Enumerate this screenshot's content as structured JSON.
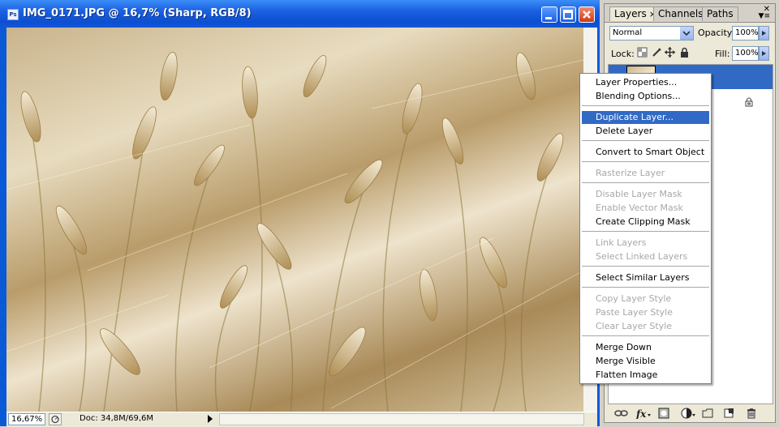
{
  "window": {
    "title": "IMG_0171.JPG @ 16,7% (Sharp, RGB/8)",
    "app_icon_text": "Ps"
  },
  "status": {
    "zoom": "16,67%",
    "doc_info": "Doc: 34,8M/69,6M"
  },
  "layers_panel": {
    "tabs": [
      {
        "label": "Layers",
        "active": true,
        "close": "×"
      },
      {
        "label": "Channels",
        "active": false
      },
      {
        "label": "Paths",
        "active": false
      }
    ],
    "blend_mode": "Normal",
    "opacity_label": "Opacity:",
    "opacity_value": "100%",
    "lock_label": "Lock:",
    "fill_label": "Fill:",
    "fill_value": "100%"
  },
  "context_menu": {
    "items": [
      {
        "label": "Layer Properties...",
        "enabled": true
      },
      {
        "label": "Blending Options...",
        "enabled": true
      },
      {
        "label": "Duplicate Layer...",
        "enabled": true,
        "highlighted": true
      },
      {
        "label": "Delete Layer",
        "enabled": true
      },
      {
        "label": "Convert to Smart Object",
        "enabled": true
      },
      {
        "label": "Rasterize Layer",
        "enabled": false
      },
      {
        "label": "Disable Layer Mask",
        "enabled": false
      },
      {
        "label": "Enable Vector Mask",
        "enabled": false
      },
      {
        "label": "Create Clipping Mask",
        "enabled": true
      },
      {
        "label": "Link Layers",
        "enabled": false
      },
      {
        "label": "Select Linked Layers",
        "enabled": false
      },
      {
        "label": "Select Similar Layers",
        "enabled": true
      },
      {
        "label": "Copy Layer Style",
        "enabled": false
      },
      {
        "label": "Paste Layer Style",
        "enabled": false
      },
      {
        "label": "Clear Layer Style",
        "enabled": false
      },
      {
        "label": "Merge Down",
        "enabled": true
      },
      {
        "label": "Merge Visible",
        "enabled": true
      },
      {
        "label": "Flatten Image",
        "enabled": true
      }
    ]
  },
  "colors": {
    "selection": "#316ac5",
    "title_bar": "#0b50d0",
    "disabled_text": "#a7a6aa"
  }
}
